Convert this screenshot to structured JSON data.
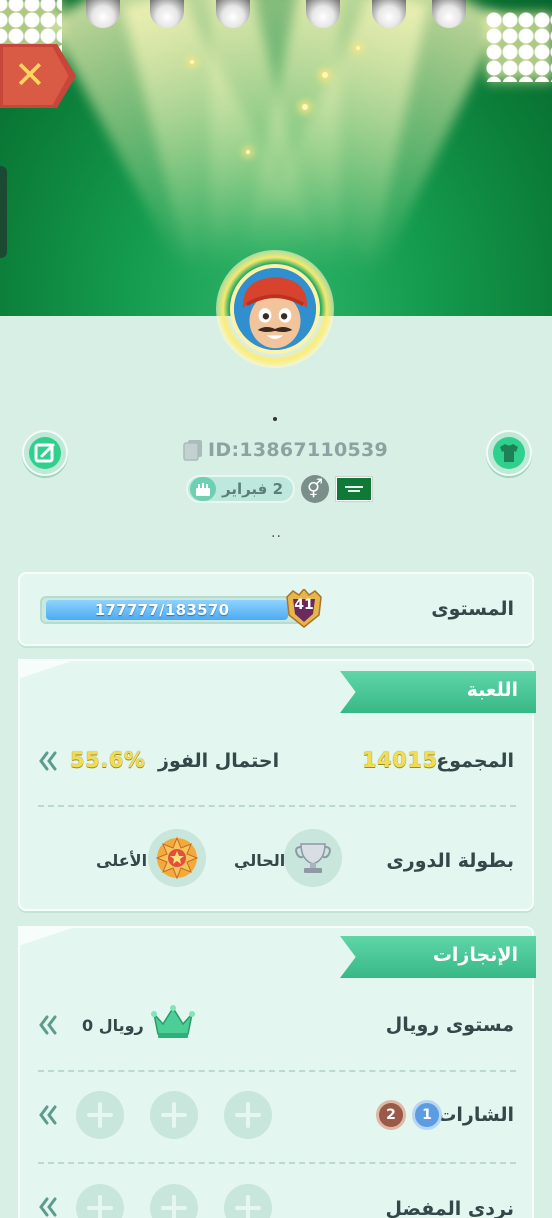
{
  "header": {
    "close_icon": "close-x-icon",
    "accent_close": "#d95a45"
  },
  "profile": {
    "name_placeholder": ".",
    "player_id": "ID:13867110539",
    "birthday": "2 فبراير",
    "gender_icon": "gender-neutral-icon",
    "country_flag": "saudi-arabia-flag",
    "status_text": "..",
    "edit_icon": "edit-icon",
    "outfit_icon": "tshirt-icon"
  },
  "level": {
    "label": "المستوى",
    "xp_text": "177777/183570",
    "xp_current": 177777,
    "xp_max": 183570,
    "level_number": "41"
  },
  "game": {
    "title": "اللعبة",
    "total_label": "المجموع",
    "total_value": "14015",
    "win_rate_label": "احتمال الفوز",
    "win_rate_value": "55.6%",
    "league_label": "بطولة الدورى",
    "current_label": "الحالي",
    "highest_label": "الأعلى"
  },
  "achievements": {
    "title": "الإنجازات",
    "royal_label": "مستوى رويال",
    "royal_value": "رويال 0",
    "badges_label": "الشارات",
    "badge_1": "1",
    "badge_2": "2",
    "favorite_dice_label": "نردي المفضل"
  }
}
